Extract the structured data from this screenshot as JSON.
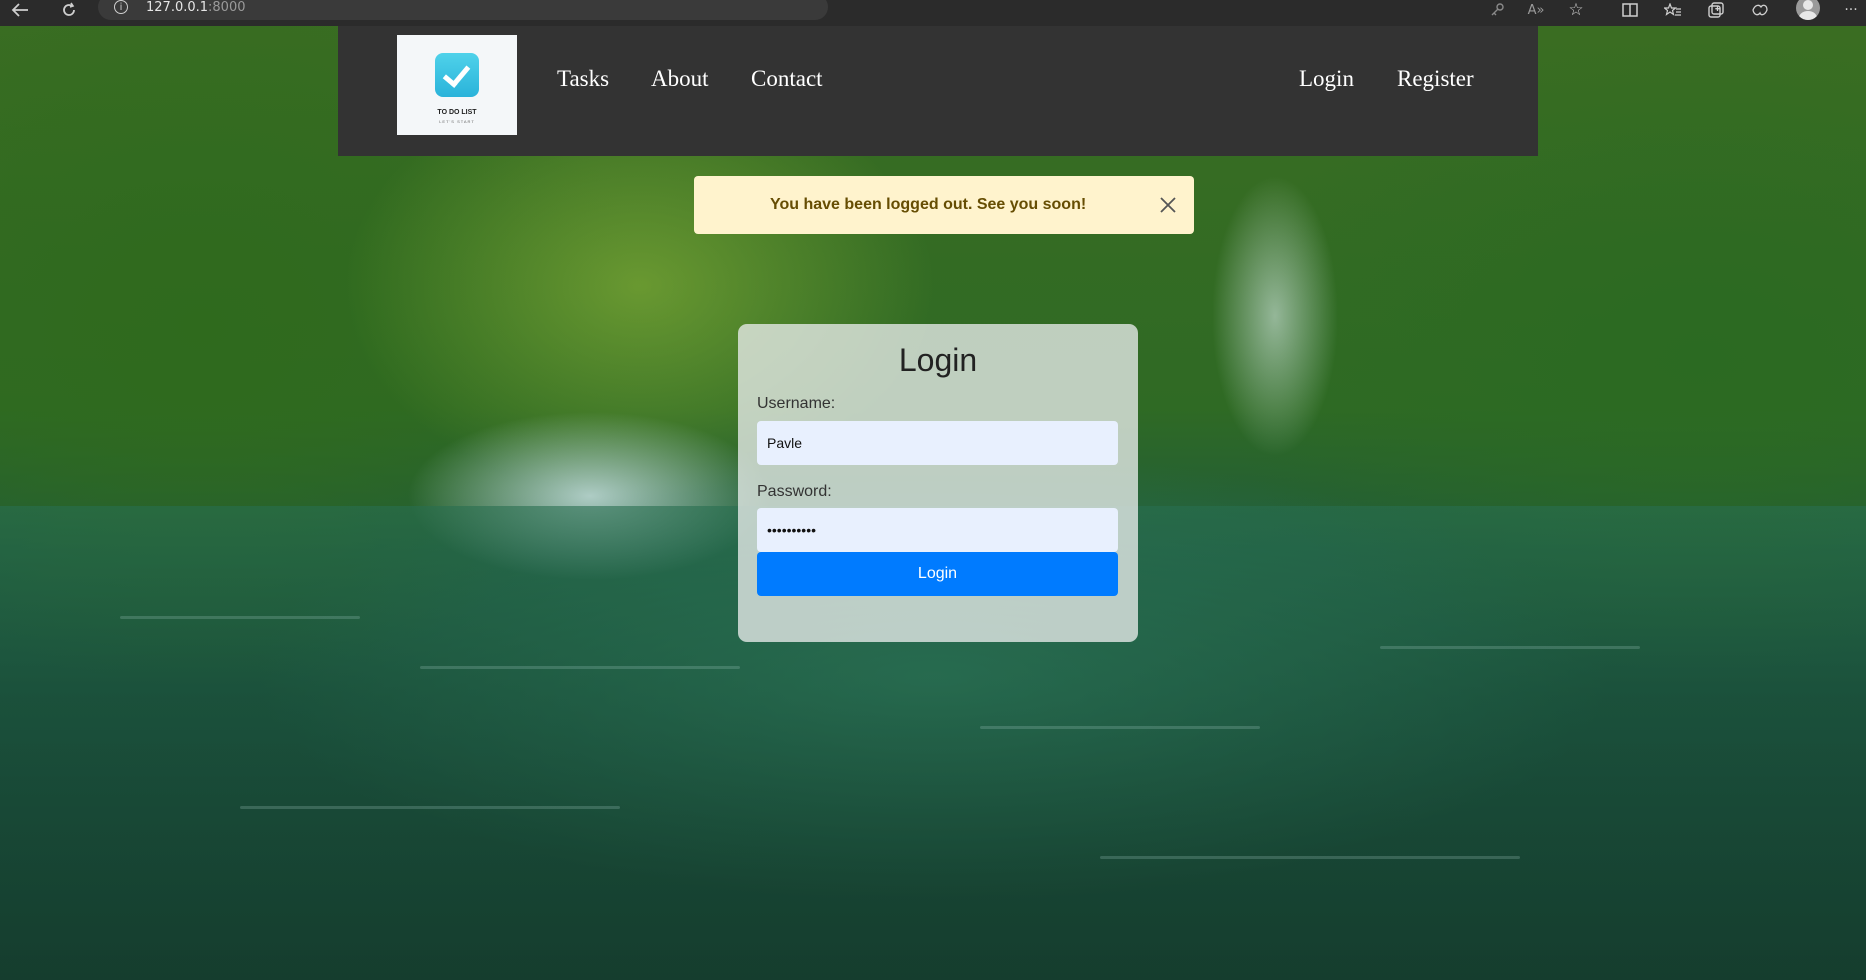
{
  "browser": {
    "address_host": "127.0.0.1",
    "address_port": ":8000",
    "icons": [
      "back-icon",
      "reload-icon",
      "info-icon",
      "key-icon",
      "read-aloud-icon",
      "favorite-star-icon",
      "split-screen-icon",
      "favorites-icon",
      "collections-icon",
      "extensions-icon",
      "profile-icon",
      "more-icon"
    ]
  },
  "navbar": {
    "logo_text": "TO DO LIST",
    "logo_subtext": "LET'S START",
    "links": {
      "tasks": "Tasks",
      "about": "About",
      "contact": "Contact",
      "login": "Login",
      "register": "Register"
    }
  },
  "alert": {
    "message": "You have been logged out. See you soon!",
    "color_bg": "#fff3cd",
    "color_text": "#664d03"
  },
  "login_form": {
    "title": "Login",
    "username_label": "Username:",
    "username_value": "Pavle",
    "password_label": "Password:",
    "password_value": "••••••••••",
    "submit_label": "Login",
    "button_color": "#007bff"
  }
}
